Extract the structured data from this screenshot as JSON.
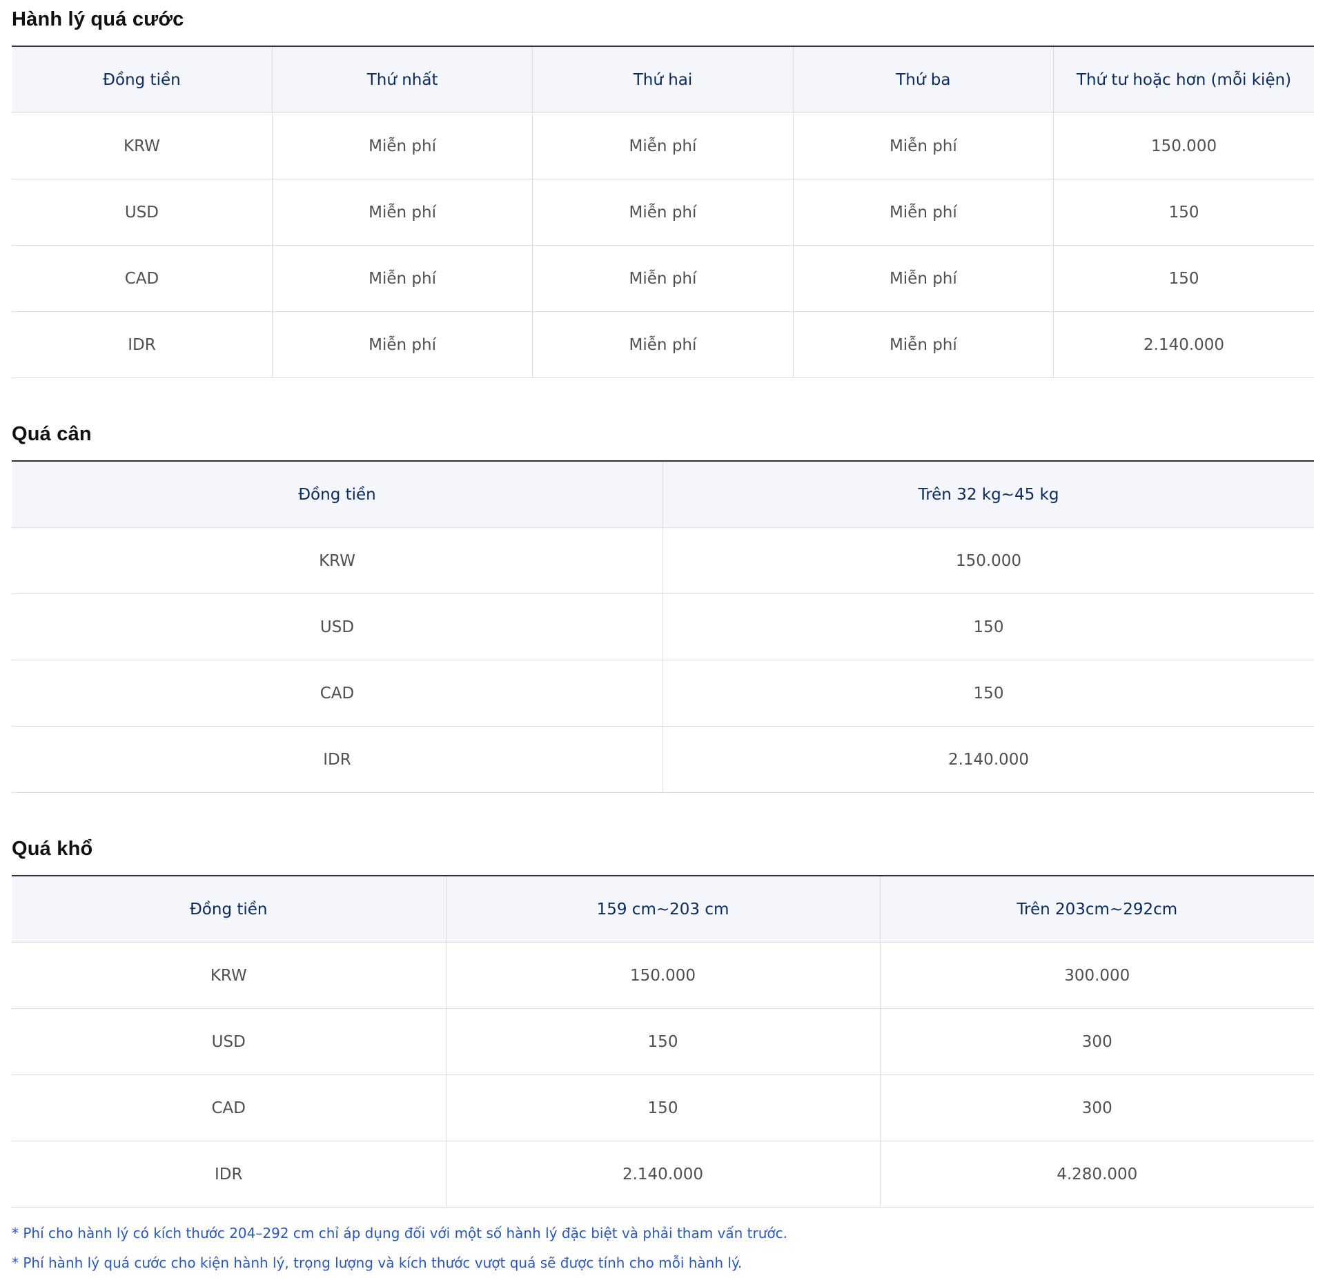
{
  "sections": [
    {
      "title": "Hành lý quá cước",
      "headers": [
        "Đồng tiền",
        "Thứ nhất",
        "Thứ hai",
        "Thứ ba",
        "Thứ tư hoặc hơn (mỗi kiện)"
      ],
      "rows": [
        [
          "KRW",
          "Miễn phí",
          "Miễn phí",
          "Miễn phí",
          "150.000"
        ],
        [
          "USD",
          "Miễn phí",
          "Miễn phí",
          "Miễn phí",
          "150"
        ],
        [
          "CAD",
          "Miễn phí",
          "Miễn phí",
          "Miễn phí",
          "150"
        ],
        [
          "IDR",
          "Miễn phí",
          "Miễn phí",
          "Miễn phí",
          "2.140.000"
        ]
      ]
    },
    {
      "title": "Quá cân",
      "headers": [
        "Đồng tiền",
        "Trên 32 kg~45 kg"
      ],
      "rows": [
        [
          "KRW",
          "150.000"
        ],
        [
          "USD",
          "150"
        ],
        [
          "CAD",
          "150"
        ],
        [
          "IDR",
          "2.140.000"
        ]
      ]
    },
    {
      "title": "Quá khổ",
      "headers": [
        "Đồng tiền",
        "159 cm~203 cm",
        "Trên 203cm~292cm"
      ],
      "rows": [
        [
          "KRW",
          "150.000",
          "300.000"
        ],
        [
          "USD",
          "150",
          "300"
        ],
        [
          "CAD",
          "150",
          "300"
        ],
        [
          "IDR",
          "2.140.000",
          "4.280.000"
        ]
      ]
    }
  ],
  "notes": [
    "* Phí cho hành lý có kích thước 204–292 cm chỉ áp dụng đối với một số hành lý đặc biệt và phải tham vấn trước.",
    "* Phí hành lý quá cước cho kiện hành lý, trọng lượng và kích thước vượt quá sẽ được tính cho mỗi hành lý."
  ],
  "colors": {
    "header_bg": "#f4f6fb",
    "header_text": "#0a2a5c",
    "table_top_rule": "#2c2f33",
    "grid_line": "#dcdde0",
    "note_text": "#2a57b8"
  }
}
